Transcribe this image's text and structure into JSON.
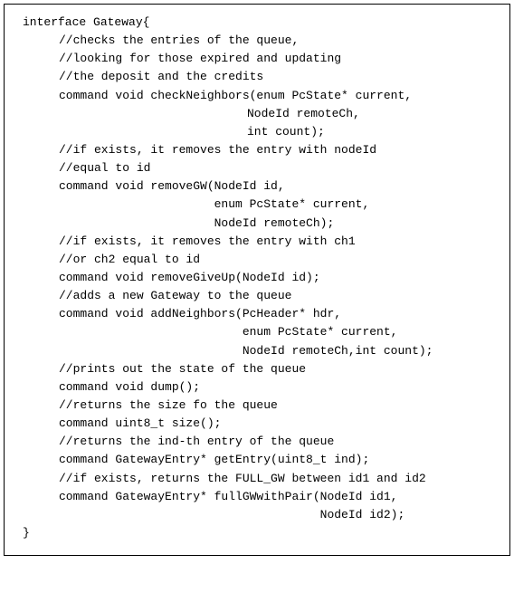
{
  "code": {
    "lines": [
      {
        "indent": 0,
        "text": "interface Gateway{"
      },
      {
        "indent": 1,
        "text": "//checks the entries of the queue,"
      },
      {
        "indent": 1,
        "text": "//looking for those expired and updating"
      },
      {
        "indent": 1,
        "text": "//the deposit and the credits"
      },
      {
        "indent": 1,
        "text": "command void checkNeighbors(enum PcState* current,"
      },
      {
        "indent": 2,
        "text": "NodeId remoteCh,"
      },
      {
        "indent": 2,
        "text": "int count);"
      },
      {
        "indent": 1,
        "text": "//if exists, it removes the entry with nodeId"
      },
      {
        "indent": 1,
        "text": "//equal to id"
      },
      {
        "indent": 1,
        "text": "command void removeGW(NodeId id,"
      },
      {
        "indent": 1,
        "text": "                      enum PcState* current,"
      },
      {
        "indent": 1,
        "text": "                      NodeId remoteCh);"
      },
      {
        "indent": 1,
        "text": "//if exists, it removes the entry with ch1"
      },
      {
        "indent": 1,
        "text": "//or ch2 equal to id"
      },
      {
        "indent": 1,
        "text": "command void removeGiveUp(NodeId id);"
      },
      {
        "indent": 1,
        "text": "//adds a new Gateway to the queue"
      },
      {
        "indent": 1,
        "text": "command void addNeighbors(PcHeader* hdr,"
      },
      {
        "indent": 1,
        "text": "                          enum PcState* current,"
      },
      {
        "indent": 1,
        "text": "                          NodeId remoteCh,int count);"
      },
      {
        "indent": 1,
        "text": "//prints out the state of the queue"
      },
      {
        "indent": 1,
        "text": "command void dump();"
      },
      {
        "indent": 1,
        "text": "//returns the size fo the queue"
      },
      {
        "indent": 1,
        "text": "command uint8_t size();"
      },
      {
        "indent": 1,
        "text": "//returns the ind-th entry of the queue"
      },
      {
        "indent": 1,
        "text": "command GatewayEntry* getEntry(uint8_t ind);"
      },
      {
        "indent": 1,
        "text": "//if exists, returns the FULL_GW between id1 and id2"
      },
      {
        "indent": 1,
        "text": "command GatewayEntry* fullGWwithPair(NodeId id1,"
      },
      {
        "indent": 1,
        "text": "                                     NodeId id2);"
      },
      {
        "indent": 0,
        "text": "}"
      }
    ]
  }
}
